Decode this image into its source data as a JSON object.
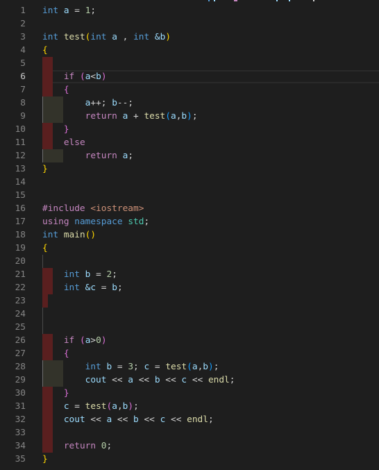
{
  "editor": {
    "language": "C++",
    "current_line": 6,
    "colors": {
      "background": "#1e1e1e",
      "line_number": "#858585",
      "line_number_active": "#c6c6c6",
      "indent_level1": "#5a1f1f",
      "indent_level2": "#33332a",
      "keyword": "#569cd6",
      "control": "#c586c0",
      "function": "#dcdcaa",
      "variable": "#9cdcfe",
      "number": "#b5cea8",
      "string": "#ce9178",
      "namespace": "#4ec9b0",
      "text": "#d4d4d4",
      "bracket1": "#ffd700",
      "bracket2": "#da70d6",
      "bracket3": "#179fff"
    },
    "lines": [
      {
        "n": "1",
        "indent": "",
        "tokens": [
          [
            "int",
            "keyword"
          ],
          [
            " ",
            "text"
          ],
          [
            "a",
            "variable"
          ],
          [
            " = ",
            "text"
          ],
          [
            "1",
            "number"
          ],
          [
            ";",
            "text"
          ]
        ]
      },
      {
        "n": "2",
        "indent": "",
        "tokens": []
      },
      {
        "n": "3",
        "indent": "",
        "tokens": [
          [
            "int",
            "keyword"
          ],
          [
            " ",
            "text"
          ],
          [
            "test",
            "function"
          ],
          [
            "(",
            "bracket1"
          ],
          [
            "int",
            "keyword"
          ],
          [
            " ",
            "text"
          ],
          [
            "a",
            "variable"
          ],
          [
            " , ",
            "text"
          ],
          [
            "int",
            "keyword"
          ],
          [
            " ",
            "text"
          ],
          [
            "&b",
            "variable"
          ],
          [
            ")",
            "bracket1"
          ]
        ]
      },
      {
        "n": "4",
        "indent": "",
        "tokens": [
          [
            "{",
            "bracket1"
          ]
        ]
      },
      {
        "n": "5",
        "indent": "red",
        "tokens": []
      },
      {
        "n": "6",
        "indent": "red",
        "tokens": [
          [
            "    ",
            "text"
          ],
          [
            "if",
            "control"
          ],
          [
            " ",
            "text"
          ],
          [
            "(",
            "bracket2"
          ],
          [
            "a",
            "variable"
          ],
          [
            "<",
            "text"
          ],
          [
            "b",
            "variable"
          ],
          [
            ")",
            "bracket2"
          ]
        ]
      },
      {
        "n": "7",
        "indent": "red",
        "tokens": [
          [
            "    ",
            "text"
          ],
          [
            "{",
            "bracket2"
          ]
        ]
      },
      {
        "n": "8",
        "indent": "olive",
        "tokens": [
          [
            "        ",
            "text"
          ],
          [
            "a",
            "variable"
          ],
          [
            "++; ",
            "text"
          ],
          [
            "b",
            "variable"
          ],
          [
            "--;",
            "text"
          ]
        ]
      },
      {
        "n": "9",
        "indent": "olive",
        "tokens": [
          [
            "        ",
            "text"
          ],
          [
            "return",
            "control"
          ],
          [
            " ",
            "text"
          ],
          [
            "a",
            "variable"
          ],
          [
            " + ",
            "text"
          ],
          [
            "test",
            "function"
          ],
          [
            "(",
            "bracket3"
          ],
          [
            "a",
            "variable"
          ],
          [
            ",",
            "text"
          ],
          [
            "b",
            "variable"
          ],
          [
            ")",
            "bracket3"
          ],
          [
            ";",
            "text"
          ]
        ]
      },
      {
        "n": "10",
        "indent": "red",
        "tokens": [
          [
            "    ",
            "text"
          ],
          [
            "}",
            "bracket2"
          ]
        ]
      },
      {
        "n": "11",
        "indent": "red",
        "tokens": [
          [
            "    ",
            "text"
          ],
          [
            "else",
            "control"
          ]
        ]
      },
      {
        "n": "12",
        "indent": "olive",
        "tokens": [
          [
            "        ",
            "text"
          ],
          [
            "return",
            "control"
          ],
          [
            " ",
            "text"
          ],
          [
            "a",
            "variable"
          ],
          [
            ";",
            "text"
          ]
        ]
      },
      {
        "n": "13",
        "indent": "",
        "tokens": [
          [
            "}",
            "bracket1"
          ]
        ]
      },
      {
        "n": "14",
        "indent": "",
        "tokens": []
      },
      {
        "n": "15",
        "indent": "",
        "tokens": []
      },
      {
        "n": "16",
        "indent": "",
        "tokens": [
          [
            "#include",
            "control"
          ],
          [
            " ",
            "text"
          ],
          [
            "<iostream>",
            "string"
          ]
        ]
      },
      {
        "n": "17",
        "indent": "",
        "tokens": [
          [
            "using",
            "control"
          ],
          [
            " ",
            "text"
          ],
          [
            "namespace",
            "keyword"
          ],
          [
            " ",
            "text"
          ],
          [
            "std",
            "namespace"
          ],
          [
            ";",
            "text"
          ]
        ]
      },
      {
        "n": "18",
        "indent": "",
        "tokens": [
          [
            "int",
            "keyword"
          ],
          [
            " ",
            "text"
          ],
          [
            "main",
            "function"
          ],
          [
            "()",
            "bracket1"
          ]
        ]
      },
      {
        "n": "19",
        "indent": "",
        "tokens": [
          [
            "{",
            "bracket1"
          ]
        ]
      },
      {
        "n": "20",
        "indent": "guide",
        "tokens": []
      },
      {
        "n": "21",
        "indent": "red",
        "tokens": [
          [
            "    ",
            "text"
          ],
          [
            "int",
            "keyword"
          ],
          [
            " ",
            "text"
          ],
          [
            "b",
            "variable"
          ],
          [
            " = ",
            "text"
          ],
          [
            "2",
            "number"
          ],
          [
            ";",
            "text"
          ]
        ]
      },
      {
        "n": "22",
        "indent": "red",
        "tokens": [
          [
            "    ",
            "text"
          ],
          [
            "int",
            "keyword"
          ],
          [
            " ",
            "text"
          ],
          [
            "&c",
            "variable"
          ],
          [
            " = ",
            "text"
          ],
          [
            "b",
            "variable"
          ],
          [
            ";",
            "text"
          ]
        ]
      },
      {
        "n": "23",
        "indent": "red-narrow",
        "tokens": []
      },
      {
        "n": "24",
        "indent": "guide",
        "tokens": []
      },
      {
        "n": "25",
        "indent": "guide",
        "tokens": []
      },
      {
        "n": "26",
        "indent": "red",
        "tokens": [
          [
            "    ",
            "text"
          ],
          [
            "if",
            "control"
          ],
          [
            " ",
            "text"
          ],
          [
            "(",
            "bracket2"
          ],
          [
            "a",
            "variable"
          ],
          [
            ">",
            "text"
          ],
          [
            "0",
            "number"
          ],
          [
            ")",
            "bracket2"
          ]
        ]
      },
      {
        "n": "27",
        "indent": "red",
        "tokens": [
          [
            "    ",
            "text"
          ],
          [
            "{",
            "bracket2"
          ]
        ]
      },
      {
        "n": "28",
        "indent": "olive",
        "tokens": [
          [
            "        ",
            "text"
          ],
          [
            "int",
            "keyword"
          ],
          [
            " ",
            "text"
          ],
          [
            "b",
            "variable"
          ],
          [
            " = ",
            "text"
          ],
          [
            "3",
            "number"
          ],
          [
            "; ",
            "text"
          ],
          [
            "c",
            "variable"
          ],
          [
            " = ",
            "text"
          ],
          [
            "test",
            "function"
          ],
          [
            "(",
            "bracket3"
          ],
          [
            "a",
            "variable"
          ],
          [
            ",",
            "text"
          ],
          [
            "b",
            "variable"
          ],
          [
            ")",
            "bracket3"
          ],
          [
            ";",
            "text"
          ]
        ]
      },
      {
        "n": "29",
        "indent": "olive",
        "tokens": [
          [
            "        ",
            "text"
          ],
          [
            "cout",
            "variable"
          ],
          [
            " << ",
            "text"
          ],
          [
            "a",
            "variable"
          ],
          [
            " << ",
            "text"
          ],
          [
            "b",
            "variable"
          ],
          [
            " << ",
            "text"
          ],
          [
            "c",
            "variable"
          ],
          [
            " << ",
            "text"
          ],
          [
            "endl",
            "function"
          ],
          [
            ";",
            "text"
          ]
        ]
      },
      {
        "n": "30",
        "indent": "red",
        "tokens": [
          [
            "    ",
            "text"
          ],
          [
            "}",
            "bracket2"
          ]
        ]
      },
      {
        "n": "31",
        "indent": "red",
        "tokens": [
          [
            "    ",
            "text"
          ],
          [
            "c",
            "variable"
          ],
          [
            " = ",
            "text"
          ],
          [
            "test",
            "function"
          ],
          [
            "(",
            "bracket2"
          ],
          [
            "a",
            "variable"
          ],
          [
            ",",
            "text"
          ],
          [
            "b",
            "variable"
          ],
          [
            ")",
            "bracket2"
          ],
          [
            ";",
            "text"
          ]
        ]
      },
      {
        "n": "32",
        "indent": "red",
        "tokens": [
          [
            "    ",
            "text"
          ],
          [
            "cout",
            "variable"
          ],
          [
            " << ",
            "text"
          ],
          [
            "a",
            "variable"
          ],
          [
            " << ",
            "text"
          ],
          [
            "b",
            "variable"
          ],
          [
            " << ",
            "text"
          ],
          [
            "c",
            "variable"
          ],
          [
            " << ",
            "text"
          ],
          [
            "endl",
            "function"
          ],
          [
            ";",
            "text"
          ]
        ]
      },
      {
        "n": "33",
        "indent": "red",
        "tokens": []
      },
      {
        "n": "34",
        "indent": "red",
        "tokens": [
          [
            "    ",
            "text"
          ],
          [
            "return",
            "control"
          ],
          [
            " ",
            "text"
          ],
          [
            "0",
            "number"
          ],
          [
            ";",
            "text"
          ]
        ]
      },
      {
        "n": "35",
        "indent": "",
        "tokens": [
          [
            "}",
            "bracket1"
          ]
        ]
      }
    ]
  }
}
